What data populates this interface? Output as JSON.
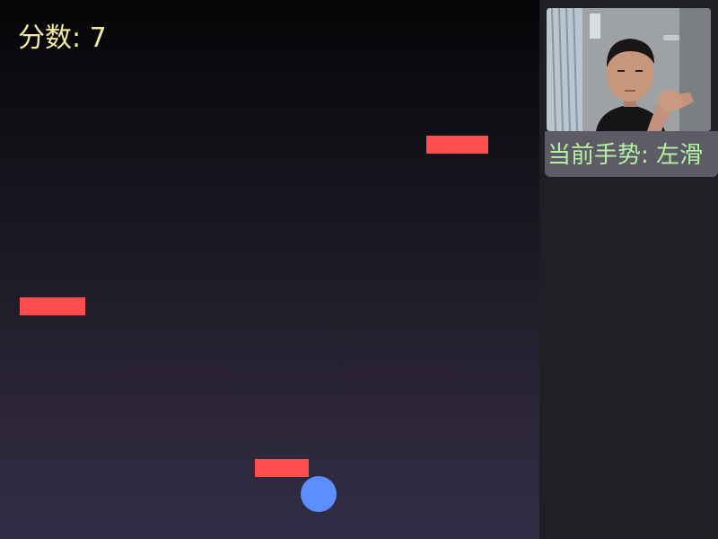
{
  "game": {
    "score_label": "分数: 7",
    "score": 7,
    "obstacle_color": "#ff4d4d",
    "ball_color": "#5b8eff",
    "score_color": "#f3e9a0"
  },
  "camera": {
    "gesture_label": "当前手势: 左滑",
    "gesture_color": "#b6f2a4"
  }
}
